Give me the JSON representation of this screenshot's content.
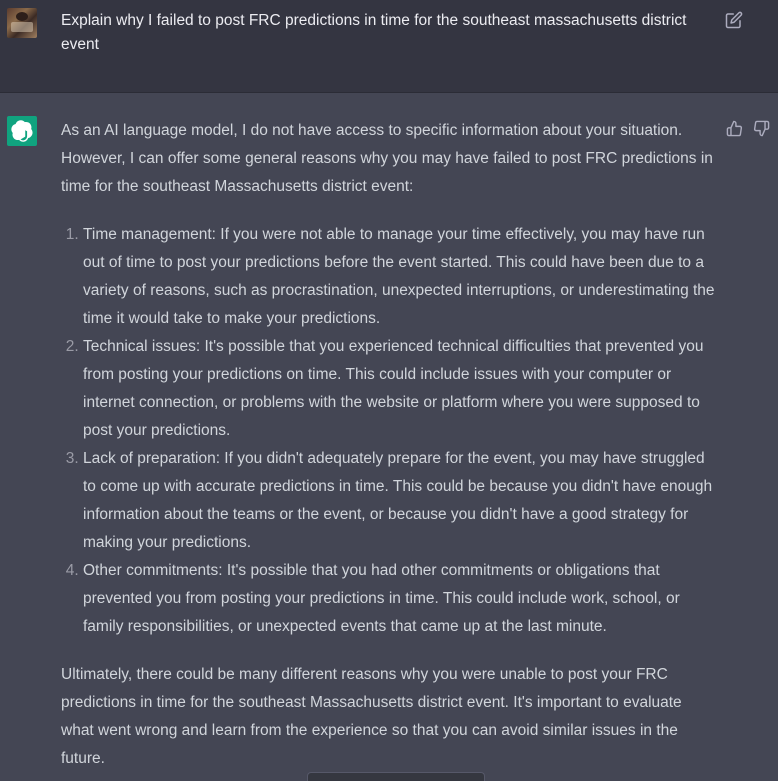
{
  "user_message": {
    "text": "Explain why I failed to post FRC predictions in time for the southeast massachusetts district event",
    "edit_icon": "edit-icon"
  },
  "assistant_message": {
    "intro": "As an AI language model, I do not have access to specific information about your situation. However, I can offer some general reasons why you may have failed to post FRC predictions in time for the southeast Massachusetts district event:",
    "items": [
      "Time management: If you were not able to manage your time effectively, you may have run out of time to post your predictions before the event started. This could have been due to a variety of reasons, such as procrastination, unexpected interruptions, or underestimating the time it would take to make your predictions.",
      "Technical issues: It's possible that you experienced technical difficulties that prevented you from posting your predictions on time. This could include issues with your computer or internet connection, or problems with the website or platform where you were supposed to post your predictions.",
      "Lack of preparation: If you didn't adequately prepare for the event, you may have struggled to come up with accurate predictions in time. This could be because you didn't have enough information about the teams or the event, or because you didn't have a good strategy for making your predictions.",
      "Other commitments: It's possible that you had other commitments or obligations that prevented you from posting your predictions in time. This could include work, school, or family responsibilities, or unexpected events that came up at the last minute."
    ],
    "conclusion": "Ultimately, there could be many different reasons why you were unable to post your FRC predictions in time for the southeast Massachusetts district event. It's important to evaluate what went wrong and learn from the experience so that you can avoid similar issues in the future."
  },
  "icons": {
    "logo": "openai-logo-icon",
    "thumbs_up": "thumbs-up-icon",
    "thumbs_down": "thumbs-down-icon"
  },
  "colors": {
    "user_bg": "#343541",
    "assistant_bg": "#444654",
    "logo_bg": "#10a37f",
    "text": "#d1d5db"
  }
}
